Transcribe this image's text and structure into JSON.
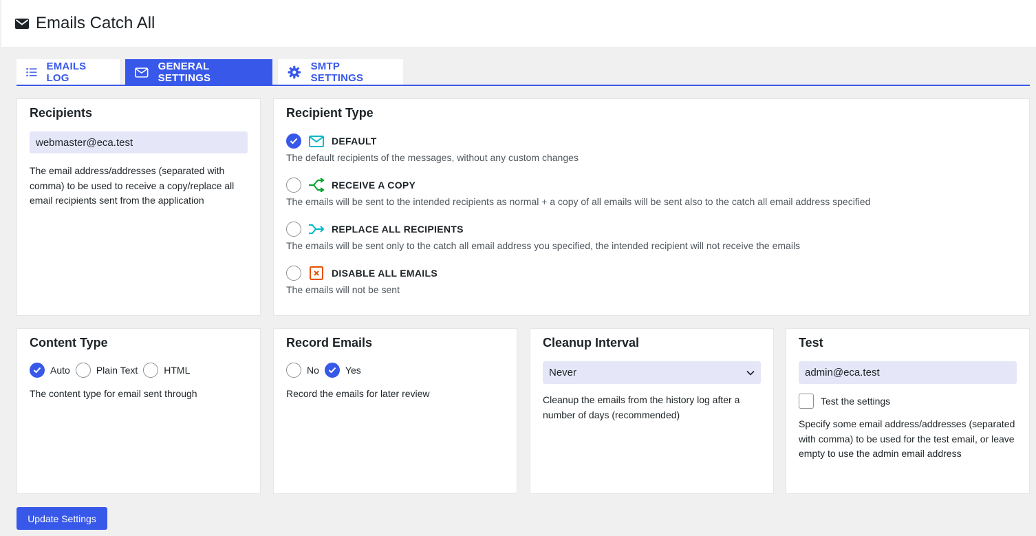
{
  "app": {
    "title": "Emails Catch All"
  },
  "tabs": [
    {
      "label": "EMAILS LOG",
      "icon": "list-icon",
      "active": false
    },
    {
      "label": "GENERAL SETTINGS",
      "icon": "envelope-icon",
      "active": true
    },
    {
      "label": "SMTP SETTINGS",
      "icon": "gear-icon",
      "active": false
    }
  ],
  "recipients": {
    "title": "Recipients",
    "value": "webmaster@eca.test",
    "help": "The email address/addresses (separated with comma) to be used to receive a copy/replace all email recipients sent from the application"
  },
  "recipient_type": {
    "title": "Recipient Type",
    "options": [
      {
        "label": "DEFAULT",
        "icon": "envelope-icon",
        "desc": "The default recipients of the messages, without any custom changes",
        "checked": true
      },
      {
        "label": "RECEIVE A COPY",
        "icon": "split-arrow-icon",
        "desc": "The emails will be sent to the intended recipients as normal + a copy of all emails will be sent also to the catch all email address specified",
        "checked": false
      },
      {
        "label": "REPLACE ALL RECIPIENTS",
        "icon": "merge-arrow-icon",
        "desc": "The emails will be sent only to the catch all email address you specified, the intended recipient will not receive the emails",
        "checked": false
      },
      {
        "label": "DISABLE ALL EMAILS",
        "icon": "x-box-icon",
        "desc": "The emails will not be sent",
        "checked": false
      }
    ]
  },
  "content_type": {
    "title": "Content Type",
    "options": [
      "Auto",
      "Plain Text",
      "HTML"
    ],
    "selected": "Auto",
    "help": "The content type for email sent through"
  },
  "record_emails": {
    "title": "Record Emails",
    "options": [
      "No",
      "Yes"
    ],
    "selected": "Yes",
    "help": "Record the emails for later review"
  },
  "cleanup": {
    "title": "Cleanup Interval",
    "selected": "Never",
    "help": "Cleanup the emails from the history log after a number of days (recommended)"
  },
  "test": {
    "title": "Test",
    "value": "admin@eca.test",
    "checkbox_label": "Test the settings",
    "help": "Specify some email address/addresses (separated with comma) to be used for the test email, or leave empty to use the admin email address"
  },
  "update_button": "Update Settings",
  "colors": {
    "accent": "#3858e9",
    "copy_green": "#00a32a",
    "replace_teal": "#00b8c8",
    "disable_orange": "#e65100"
  }
}
